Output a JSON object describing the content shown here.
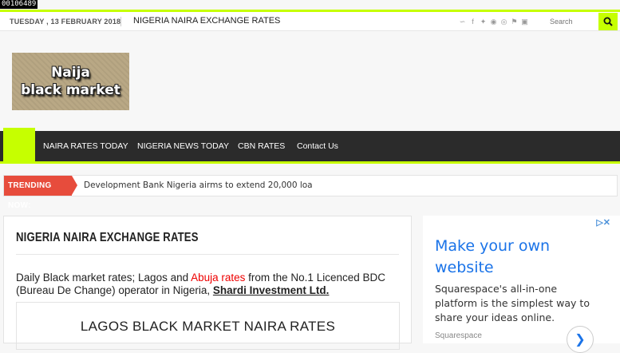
{
  "id_tag": "00106489",
  "topbar": {
    "date": "TUESDAY , 13 FEBRUARY 2018",
    "link": "NIGERIA NAIRA EXCHANGE RATES",
    "social_icons": [
      "rss-icon",
      "facebook-icon",
      "twitter-icon",
      "pinterest-icon",
      "dribbble-icon",
      "foursquare-icon",
      "instagram-icon"
    ],
    "search_placeholder": "Search"
  },
  "logo": {
    "line1": "Naija",
    "line2": "black market"
  },
  "nav": {
    "items": [
      "NAIRA RATES TODAY",
      "NIGERIA NEWS TODAY",
      "CBN RATES",
      "Contact Us"
    ]
  },
  "trending": {
    "label": "TRENDING NOW:",
    "text": "Development Bank Nigeria airms to extend 20,000 loa"
  },
  "article": {
    "title": "NIGERIA NAIRA EXCHANGE RATES",
    "intro_part1": "Daily Black market rates; Lagos and ",
    "intro_link1": "Abuja rates",
    "intro_part2": " from the No.1 Licenced BDC (Bureau De Change) operator in Nigeria, ",
    "intro_link2": "Shardi Investment Ltd.",
    "box_heading": "LAGOS BLACK MARKET NAIRA RATES"
  },
  "ad": {
    "headline": "Make your own website",
    "body": "Squarespace's all-in-one platform is the simplest way to share your ideas online.",
    "brand": "Squarespace",
    "cta_icon": "chevron-right-icon"
  },
  "colors": {
    "accent": "#c6ff00",
    "nav_bg": "#2b2b2b",
    "trending": "#e74c3c",
    "ad_link": "#1a73e8"
  }
}
